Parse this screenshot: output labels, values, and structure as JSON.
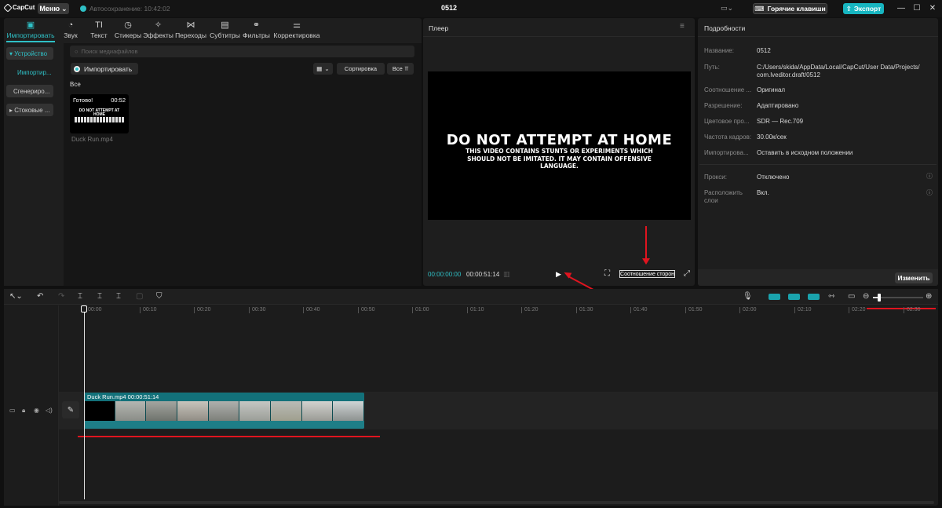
{
  "titlebar": {
    "app_name": "CapCut",
    "menu_label": "Меню",
    "autosave_text": "Автосохранение: 10:42:02",
    "project_title": "0512",
    "hotkeys_label": "Горячие клавиши",
    "export_label": "Экспорт"
  },
  "toolbar": {
    "tabs": [
      {
        "label": "Импортировать",
        "icon": "import-icon",
        "glyph": "▣"
      },
      {
        "label": "Звук",
        "icon": "audio-icon",
        "glyph": "◔"
      },
      {
        "label": "Текст",
        "icon": "text-icon",
        "glyph": "TI"
      },
      {
        "label": "Стикеры",
        "icon": "sticker-icon",
        "glyph": "◷"
      },
      {
        "label": "Эффекты",
        "icon": "effects-icon",
        "glyph": "✧"
      },
      {
        "label": "Переходы",
        "icon": "transitions-icon",
        "glyph": "⋈"
      },
      {
        "label": "Субтитры",
        "icon": "captions-icon",
        "glyph": "▤"
      },
      {
        "label": "Фильтры",
        "icon": "filters-icon",
        "glyph": "⚭"
      },
      {
        "label": "Корректировка",
        "icon": "adjust-icon",
        "glyph": "⚌"
      }
    ]
  },
  "media": {
    "side": {
      "device": "▾ Устройство",
      "import": "Импортир...",
      "generated": "Сгенериро...",
      "stock": "▸ Стоковые ..."
    },
    "search_placeholder": "Поиск медиафайлов",
    "import_button": "Импортировать",
    "sort_label": "Сортировка",
    "filter_label": "Все",
    "all_label": "Все",
    "clip": {
      "status": "Готово!",
      "duration": "00:52",
      "thumb_text": "DO NOT ATTEMPT AT HOME",
      "name": "Duck Run.mp4"
    }
  },
  "player": {
    "title": "Плеер",
    "headline": "DO NOT ATTEMPT AT HOME",
    "subtext": "THIS VIDEO CONTAINS STUNTS OR EXPERIMENTS WHICH SHOULD NOT BE IMITATED. IT MAY CONTAIN OFFENSIVE LANGUAGE.",
    "time_current": "00:00:00:00",
    "time_total": "00:00:51:14",
    "ratio_label": "Соотношение сторон"
  },
  "details": {
    "title": "Подробности",
    "rows": [
      {
        "key": "Название:",
        "value": "0512"
      },
      {
        "key": "Путь:",
        "value": "C:/Users/skida/AppData/Local/CapCut/User Data/Projects/",
        "value2": "com.lveditor.draft/0512"
      },
      {
        "key": "Соотношение ...",
        "value": "Оригинал"
      },
      {
        "key": "Разрешение:",
        "value": "Адаптировано"
      },
      {
        "key": "Цветовое про...",
        "value": "SDR — Rec.709"
      },
      {
        "key": "Частота кадров:",
        "value": "30.00к/сек"
      },
      {
        "key": "Импортирова...",
        "value": "Оставить в исходном положении"
      }
    ],
    "proxy_key": "Прокси:",
    "proxy_value": "Отключено",
    "layers_key": "Расположить",
    "layers_key2": "слои",
    "layers_value": "Вкл.",
    "edit_button": "Изменить"
  },
  "timeline": {
    "ticks": [
      "00:00",
      "00:10",
      "00:20",
      "00:30",
      "00:40",
      "00:50",
      "01:00",
      "01:10",
      "01:20",
      "01:30",
      "01:40",
      "01:50",
      "02:00",
      "02:10",
      "02:20",
      "02:30"
    ],
    "clip_label": "Duck Run.mp4   00:00:51:14",
    "zoom_level": 0.12
  },
  "colors": {
    "accent": "#2fc0c6",
    "export": "#17b5c0",
    "annotation": "#e0141f"
  }
}
